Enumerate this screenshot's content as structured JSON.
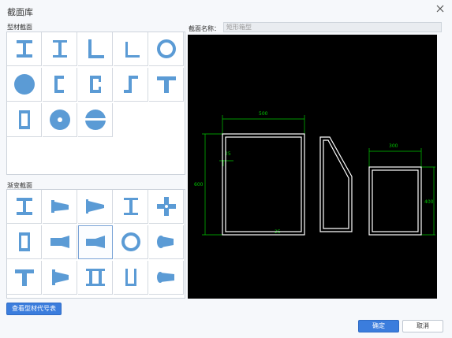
{
  "window": {
    "title": "截面库"
  },
  "left": {
    "section_type_label": "型材截面",
    "variable_section_label": "渐变截面",
    "table_button": "查看型材代号表"
  },
  "right": {
    "section_name_label": "截面名称：",
    "section_name_placeholder": "矩形箱型"
  },
  "footer": {
    "ok": "确定",
    "cancel": "取消"
  },
  "drawing": {
    "dim_top": "500",
    "dim_left": "600",
    "dim_right_top": "300",
    "dim_right_side": "400",
    "dim_bottom": "25",
    "dim_small_left": "25"
  },
  "colors": {
    "accent": "#3b7ddd",
    "icon": "#5b9bd5",
    "dim": "#00c800"
  },
  "profile_icons": [
    "i-beam-icon",
    "i-beam-welded-icon",
    "angle-icon",
    "angle-lipped-icon",
    "pipe-icon",
    "round-bar-icon",
    "c-channel-icon",
    "c-channel-lipped-icon",
    "z-section-icon",
    "t-section-icon",
    "box-section-icon",
    "disc-icon",
    "split-circle-icon"
  ],
  "variable_icons": [
    "tapered-i-icon",
    "tapered-i-side-icon",
    "tapered-i-end-icon",
    "i-beam-variable-icon",
    "cross-section-icon",
    "box-variable-icon",
    "tapered-box-icon",
    "tapered-box-selected-icon",
    "pipe-variable-icon",
    "tapered-pipe-icon",
    "t-variable-icon",
    "tapered-t-icon",
    "double-i-icon",
    "channel-variable-icon",
    "tapered-round-icon"
  ]
}
